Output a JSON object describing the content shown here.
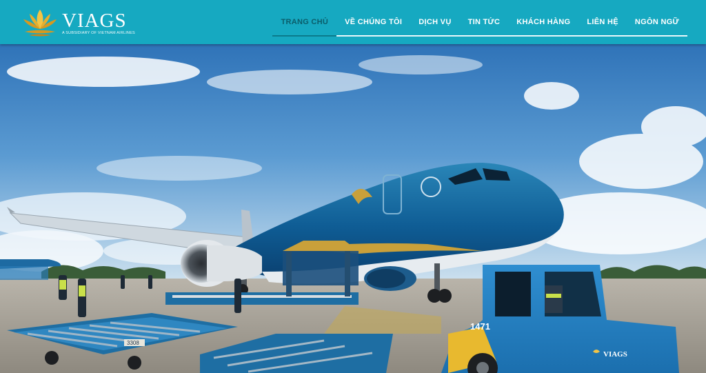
{
  "brand": {
    "name": "VIAGS",
    "subtitle": "A SUBSIDIARY OF VIETNAM AIRLINES",
    "colors": {
      "header": "#16a9c1",
      "gold": "#c9a03a",
      "navy": "#0c3d6e"
    }
  },
  "nav": {
    "items": [
      {
        "label": "TRANG CHỦ",
        "active": true
      },
      {
        "label": "VỀ CHÚNG TÔI",
        "active": false
      },
      {
        "label": "DỊCH VỤ",
        "active": false
      },
      {
        "label": "TIN TỨC",
        "active": false
      },
      {
        "label": "KHÁCH HÀNG",
        "active": false
      },
      {
        "label": "LIÊN HỆ",
        "active": false
      },
      {
        "label": "NGÔN NGỮ",
        "active": false
      }
    ]
  },
  "hero": {
    "aircraft_livery": "Vietnam Airlines",
    "tug_number": "1471",
    "tug_logo": "VIAGS",
    "dolly_number": "3308"
  }
}
